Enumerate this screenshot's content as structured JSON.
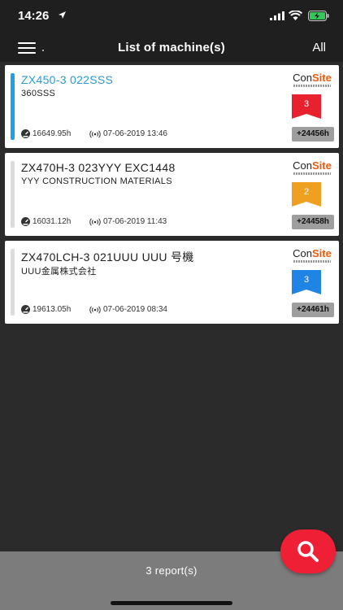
{
  "status": {
    "time": "14:26"
  },
  "nav": {
    "title": "List of machine(s)",
    "filter_label": "All"
  },
  "logo": {
    "con": "Con",
    "site": "Site"
  },
  "machines": [
    {
      "name": "ZX450-3 022SSS",
      "owner": "360SSS",
      "hours": "16649.95h",
      "datetime": "07-06-2019 13:46",
      "rank": "3",
      "rank_color": "#e8212f",
      "diff": "+24456h"
    },
    {
      "name": "ZX470H-3 023YYY EXC1448",
      "owner": "YYY CONSTRUCTION MATERIALS",
      "hours": "16031.12h",
      "datetime": "07-06-2019 11:43",
      "rank": "2",
      "rank_color": "#f0a020",
      "diff": "+24458h"
    },
    {
      "name": "ZX470LCH-3 021UUU UUU 号機",
      "owner": "UUU金属株式会社",
      "hours": "19613.05h",
      "datetime": "07-06-2019 08:34",
      "rank": "3",
      "rank_color": "#1f84e3",
      "diff": "+24461h"
    }
  ],
  "footer": {
    "report_count": "3 report(s)"
  },
  "colors": {
    "accent": "#1fa0e6",
    "fab": "#ef1f36"
  }
}
